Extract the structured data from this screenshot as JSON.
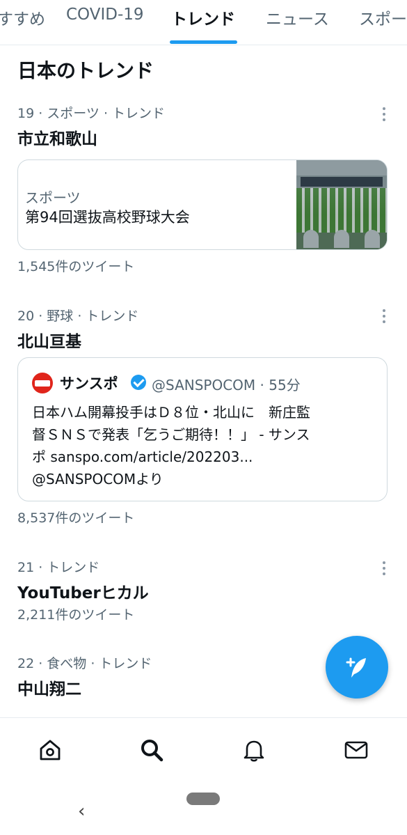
{
  "tabs": [
    "すすめ",
    "COVID-19",
    "トレンド",
    "ニュース",
    "スポー"
  ],
  "section_title": "日本のトレンド",
  "trends": [
    {
      "meta": "19 · スポーツ · トレンド",
      "name": "市立和歌山",
      "count": "1,545件のツイート",
      "card": {
        "category": "スポーツ",
        "title": "第94回選抜高校野球大会",
        "image": "stadium-image"
      }
    },
    {
      "meta": "20 · 野球 · トレンド",
      "name": "北山亘基",
      "count": "8,537件のツイート",
      "tweet": {
        "author": "サンスポ",
        "handle_time": "@SANSPOCOM · 55分",
        "line1": "日本ハム開幕投手はＤ８位・北山に　新庄監",
        "line2": "督ＳＮＳで発表「乞うご期待！！」 - サンス",
        "line3": "ポ sanspo.com/article/202203...",
        "line4": "@SANSPOCOMより"
      }
    },
    {
      "meta": "21 · トレンド",
      "name": "YouTuberヒカル",
      "count": "2,211件のツイート"
    },
    {
      "meta": "22 · 食べ物 · トレンド",
      "name": "中山翔二"
    }
  ],
  "colors": {
    "accent": "#1d9bf0",
    "secondary_text": "#536471",
    "brand_red": "#e0251b"
  },
  "icons": {
    "fab": "compose-tweet-icon",
    "nav": [
      "home-icon",
      "search-icon",
      "bell-icon",
      "mail-icon"
    ]
  }
}
